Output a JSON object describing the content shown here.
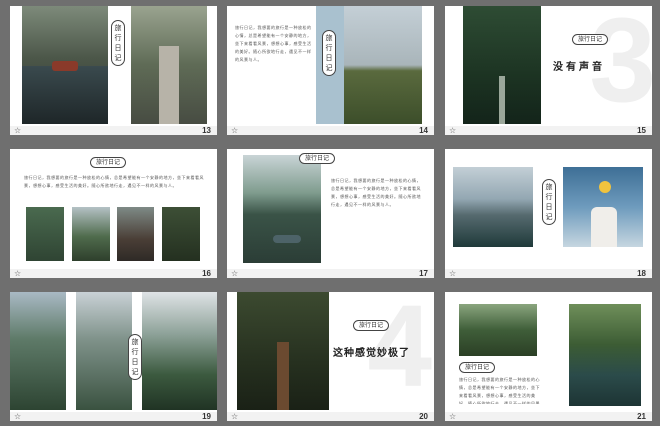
{
  "badge": "旅行日记",
  "body_text": "旅行日记，我想要的旅行是一种放松的心情，总是希望能有一个安静的地方，坐下来看看风景，想想心事，感受生活的美好。随心所欲地行走，遇见不一样的风景与人。",
  "slides": [
    {
      "num": "13"
    },
    {
      "num": "14"
    },
    {
      "num": "15",
      "headline": "没有声音",
      "ghost": "3"
    },
    {
      "num": "16"
    },
    {
      "num": "17"
    },
    {
      "num": "18"
    },
    {
      "num": "19"
    },
    {
      "num": "20",
      "headline": "这种感觉妙极了",
      "ghost": "4"
    },
    {
      "num": "21"
    }
  ],
  "icons": {
    "slide_marker": "star-icon"
  },
  "colors": {
    "background": "#6f6f6f",
    "slide": "#ffffff",
    "accent_blue": "#a9c1cf"
  }
}
